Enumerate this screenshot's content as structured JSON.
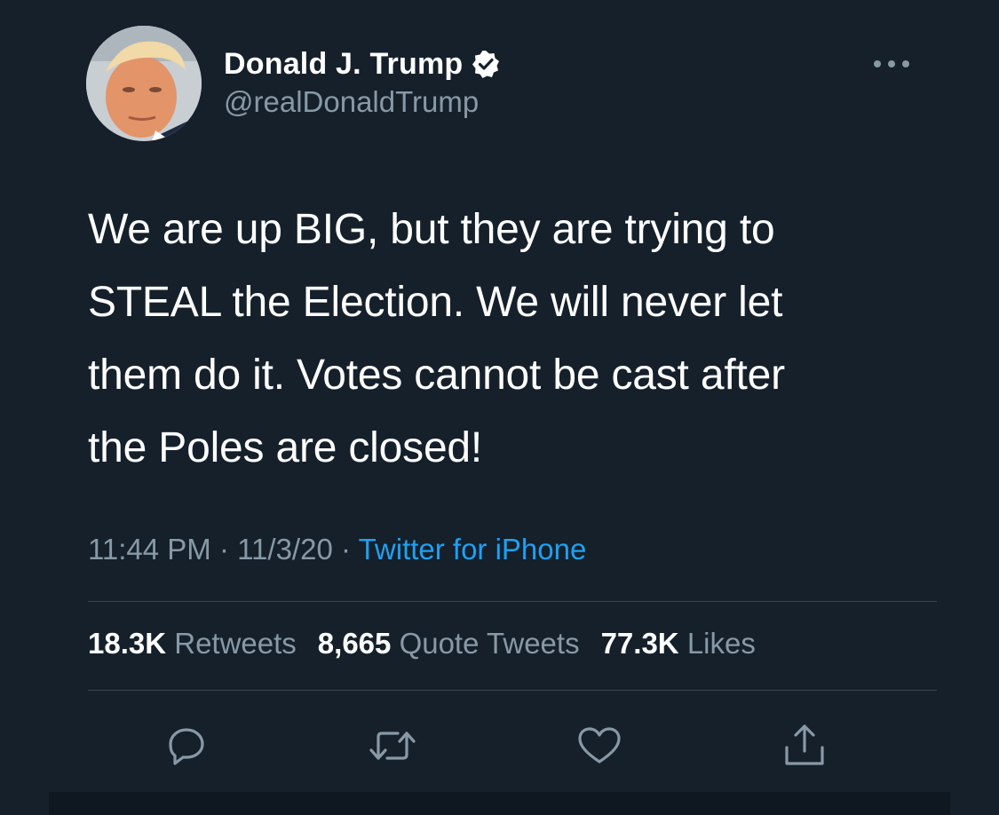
{
  "author": {
    "display_name": "Donald J. Trump",
    "handle": "@realDonaldTrump",
    "verified": true,
    "avatar_icon": "profile-photo"
  },
  "tweet": {
    "lines": [
      "We are up BIG, but they are trying to",
      "STEAL the Election. We will never let",
      "them do it. Votes cannot be cast after",
      "the Poles are closed!"
    ]
  },
  "meta": {
    "time": "11:44 PM",
    "separator": "·",
    "date": "11/3/20",
    "source": "Twitter for iPhone"
  },
  "stats": {
    "retweets_count": "18.3K",
    "retweets_label": "Retweets",
    "quotes_count": "8,665",
    "quotes_label": "Quote Tweets",
    "likes_count": "77.3K",
    "likes_label": "Likes"
  },
  "actions": [
    {
      "name": "reply",
      "icon": "reply-icon"
    },
    {
      "name": "retweet",
      "icon": "retweet-icon"
    },
    {
      "name": "like",
      "icon": "heart-icon"
    },
    {
      "name": "share",
      "icon": "share-icon"
    }
  ],
  "colors": {
    "background": "#15202b",
    "text_primary": "#ffffff",
    "text_secondary": "#8899a6",
    "accent": "#1da1f2",
    "divider": "#38444d"
  }
}
